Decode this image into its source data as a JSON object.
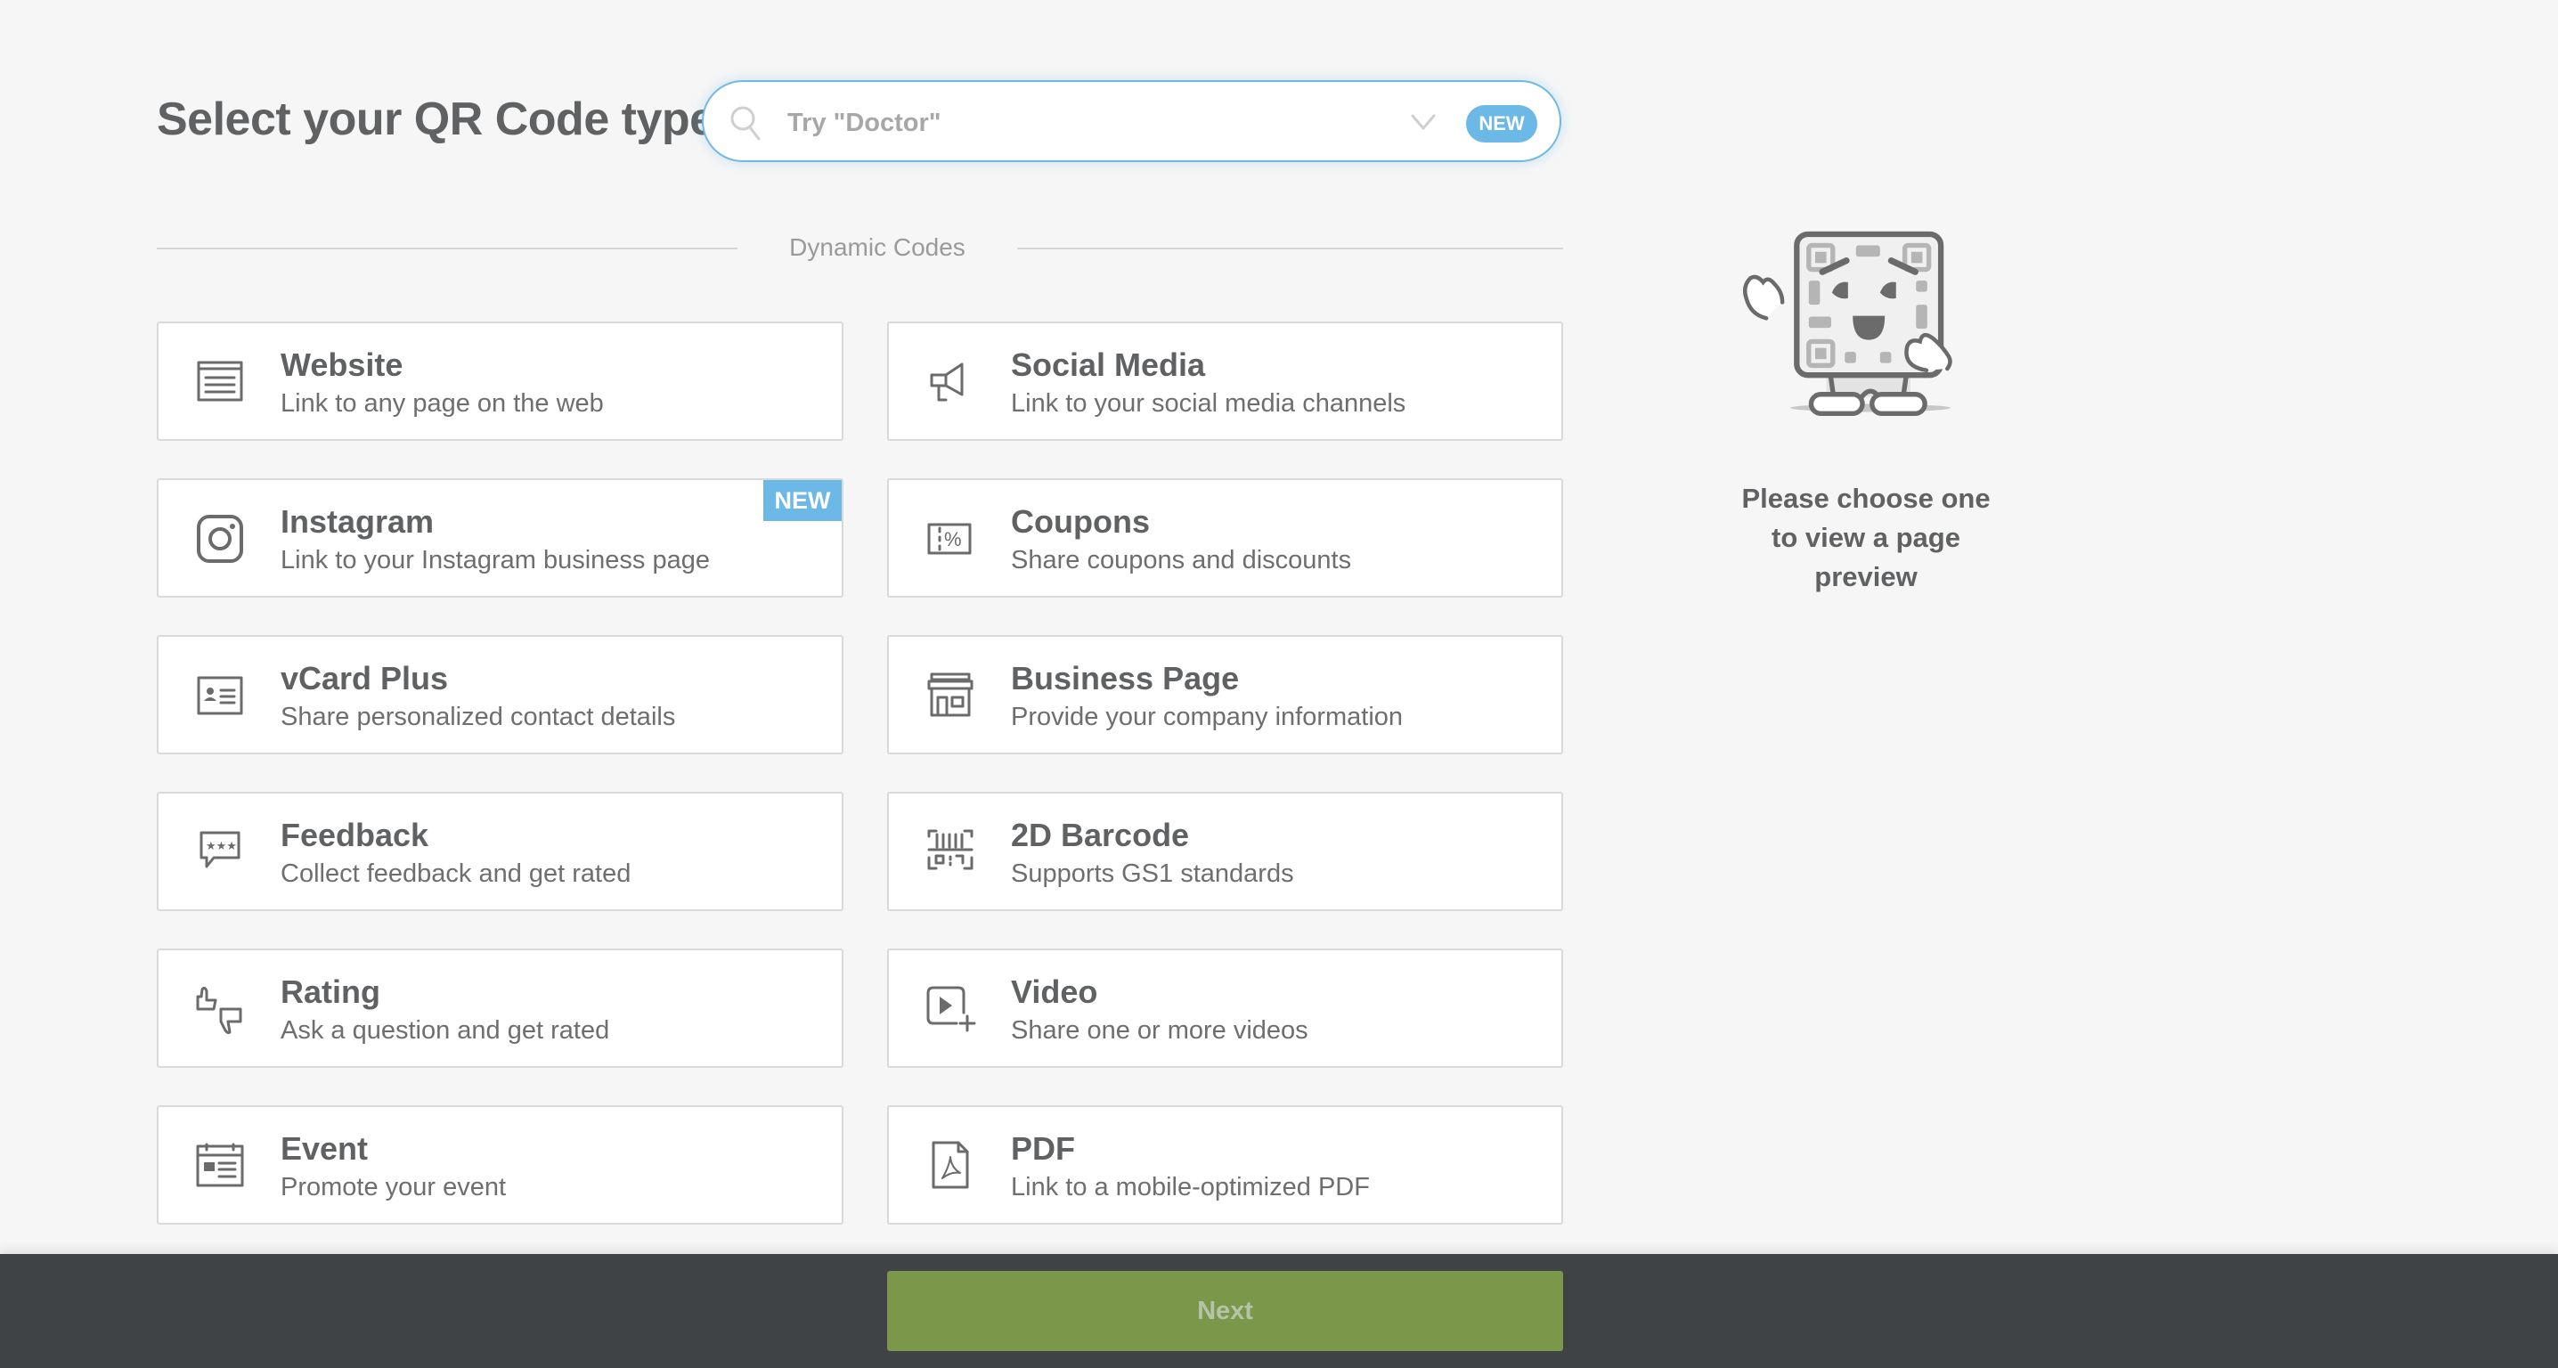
{
  "header": {
    "title": "Select your QR Code type"
  },
  "search": {
    "placeholder": "Try \"Doctor\"",
    "value": "",
    "badge": "NEW",
    "search_icon": "search-icon",
    "dropdown_icon": "chevron-down-icon"
  },
  "section": {
    "label": "Dynamic Codes"
  },
  "cards": [
    {
      "title": "Website",
      "description": "Link to any page on the web",
      "icon": "browser-window-icon",
      "badge": null
    },
    {
      "title": "Social Media",
      "description": "Link to your social media channels",
      "icon": "megaphone-icon",
      "badge": null
    },
    {
      "title": "Instagram",
      "description": "Link to your Instagram business page",
      "icon": "instagram-icon",
      "badge": "NEW"
    },
    {
      "title": "Coupons",
      "description": "Share coupons and discounts",
      "icon": "coupon-percent-icon",
      "badge": null
    },
    {
      "title": "vCard Plus",
      "description": "Share personalized contact details",
      "icon": "contact-card-icon",
      "badge": null
    },
    {
      "title": "Business Page",
      "description": "Provide your company information",
      "icon": "storefront-icon",
      "badge": null
    },
    {
      "title": "Feedback",
      "description": "Collect feedback and get rated",
      "icon": "speech-bubble-stars-icon",
      "badge": null
    },
    {
      "title": "2D Barcode",
      "description": "Supports GS1 standards",
      "icon": "barcode-scan-icon",
      "badge": null
    },
    {
      "title": "Rating",
      "description": "Ask a question and get rated",
      "icon": "thumbs-up-down-icon",
      "badge": null
    },
    {
      "title": "Video",
      "description": "Share one or more videos",
      "icon": "video-add-icon",
      "badge": null
    },
    {
      "title": "Event",
      "description": "Promote your event",
      "icon": "calendar-event-icon",
      "badge": null
    },
    {
      "title": "PDF",
      "description": "Link to a mobile-optimized PDF",
      "icon": "pdf-file-icon",
      "badge": null
    }
  ],
  "preview": {
    "illustration": "qr-mascot-waving-illustration",
    "message": "Please choose one to view a page preview"
  },
  "footer": {
    "next_label": "Next"
  },
  "colors": {
    "accent_blue": "#6cb8e6",
    "next_green": "#7a974a",
    "footer_bg": "#404346",
    "page_bg": "#f6f6f6",
    "text_dark": "#5f6163"
  }
}
